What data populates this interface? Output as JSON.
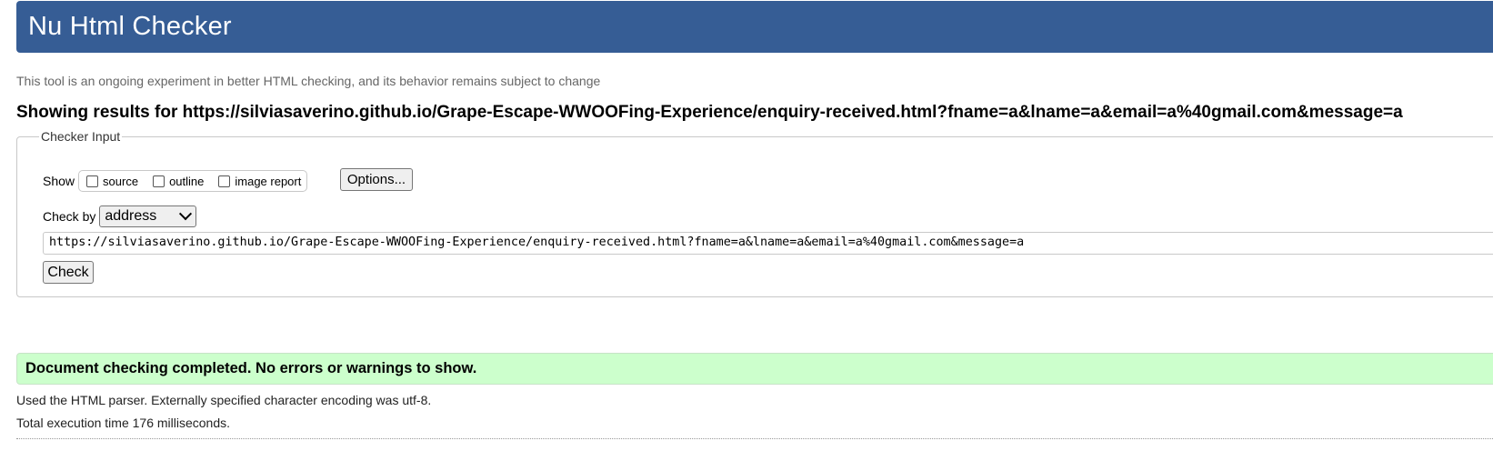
{
  "header": {
    "title": "Nu Html Checker",
    "bg_color": "#365d95"
  },
  "tagline": "This tool is an ongoing experiment in better HTML checking, and its behavior remains subject to change",
  "results_heading": "Showing results for https://silviasaverino.github.io/Grape-Escape-WWOOFing-Experience/enquiry-received.html?fname=a&lname=a&email=a%40gmail.com&message=a",
  "checker_input": {
    "legend": "Checker Input",
    "show_label": "Show",
    "show_options": [
      {
        "label": "source",
        "checked": false
      },
      {
        "label": "outline",
        "checked": false
      },
      {
        "label": "image report",
        "checked": false
      }
    ],
    "options_button": "Options...",
    "check_by_label": "Check by",
    "check_by_selected": "address",
    "url_value": "https://silviasaverino.github.io/Grape-Escape-WWOOFing-Experience/enquiry-received.html?fname=a&lname=a&email=a%40gmail.com&message=a",
    "check_button": "Check"
  },
  "result": {
    "message": "Document checking completed. No errors or warnings to show.",
    "bg_color": "#ccffcc"
  },
  "details": {
    "parser_info": "Used the HTML parser. Externally specified character encoding was utf-8.",
    "execution_time": "Total execution time 176 milliseconds."
  }
}
